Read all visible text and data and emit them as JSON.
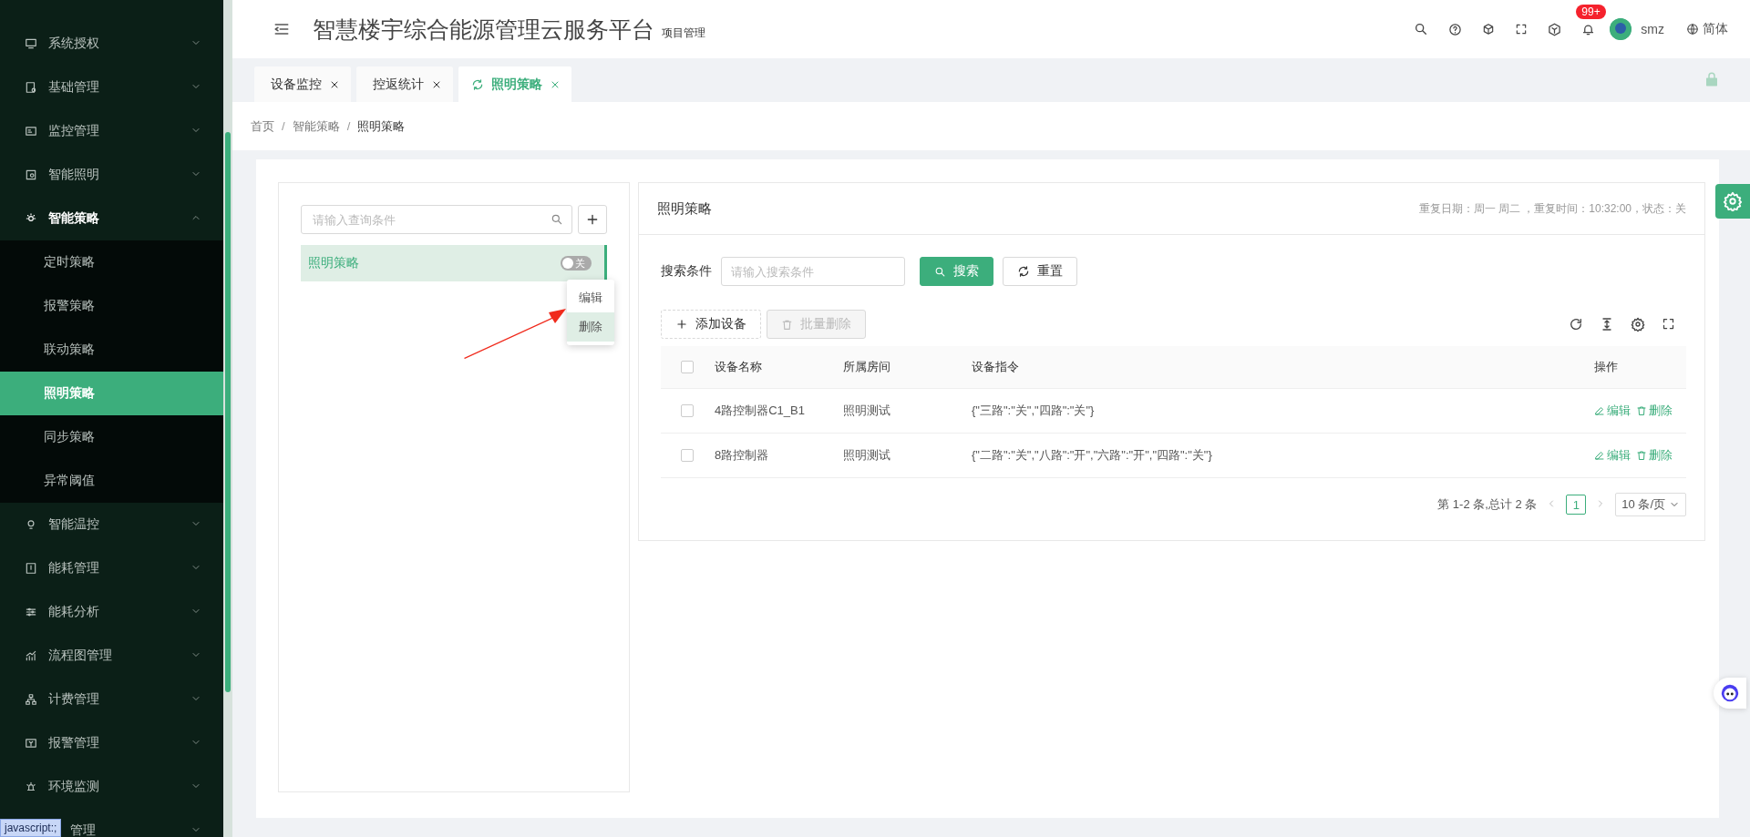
{
  "sidebar": {
    "items": [
      {
        "label": "系统授权",
        "expanded": false
      },
      {
        "label": "基础管理",
        "expanded": false
      },
      {
        "label": "监控管理",
        "expanded": false
      },
      {
        "label": "智能照明",
        "expanded": false
      },
      {
        "label": "智能策略",
        "expanded": true,
        "children": [
          {
            "label": "定时策略",
            "selected": false
          },
          {
            "label": "报警策略",
            "selected": false
          },
          {
            "label": "联动策略",
            "selected": false
          },
          {
            "label": "照明策略",
            "selected": true
          },
          {
            "label": "同步策略",
            "selected": false
          },
          {
            "label": "异常阈值",
            "selected": false
          }
        ]
      },
      {
        "label": "智能温控",
        "expanded": false
      },
      {
        "label": "能耗管理",
        "expanded": false
      },
      {
        "label": "能耗分析",
        "expanded": false
      },
      {
        "label": "流程图管理",
        "expanded": false
      },
      {
        "label": "计费管理",
        "expanded": false
      },
      {
        "label": "报警管理",
        "expanded": false
      },
      {
        "label": "环境监测",
        "expanded": false
      },
      {
        "label": "管理",
        "expanded": false
      }
    ]
  },
  "status_tooltip": "javascript:;",
  "header": {
    "title": "智慧楼宇综合能源管理云服务平台",
    "subtitle": "项目管理",
    "notification_badge": "99+",
    "user": "smz",
    "language": "简体"
  },
  "tabs": [
    {
      "label": "设备监控",
      "selected": false
    },
    {
      "label": "控返统计",
      "selected": false
    },
    {
      "label": "照明策略",
      "selected": true
    }
  ],
  "breadcrumb": [
    "首页",
    "智能策略",
    "照明策略"
  ],
  "breadcrumb_separator": "/",
  "strategy_list": {
    "search_placeholder": "请输入查询条件",
    "items": [
      {
        "label": "照明策略",
        "selected": true,
        "on": false,
        "switch_text": "关"
      }
    ],
    "context_menu": [
      {
        "label": "编辑",
        "selected": false
      },
      {
        "label": "删除",
        "selected": true
      }
    ]
  },
  "detail": {
    "title": "照明策略",
    "summary": "重复日期：周一 周二 ，重复时间：10:32:00，状态：关",
    "search_label": "搜索条件",
    "search_placeholder": "请输入搜索条件",
    "search_button": "搜索",
    "reset_button": "重置",
    "add_button": "添加设备",
    "batch_delete_button": "批量删除",
    "batch_delete_disabled": true,
    "table": {
      "select_all_checked": false,
      "columns": [
        "设备名称",
        "所属房间",
        "设备指令",
        "操作"
      ],
      "rows": [
        {
          "checked": false,
          "cells": [
            "4路控制器C1_B1",
            "照明测试",
            "{\"三路\":\"关\",\"四路\":\"关\"}"
          ],
          "actions": [
            "编辑",
            "删除"
          ]
        },
        {
          "checked": false,
          "cells": [
            "8路控制器",
            "照明测试",
            "{\"二路\":\"关\",\"八路\":\"开\",\"六路\":\"开\",\"四路\":\"关\"}"
          ],
          "actions": [
            "编辑",
            "删除"
          ]
        }
      ]
    },
    "pagination": {
      "summary": "第 1-2 条,总计 2 条",
      "pages": [
        {
          "label": "1",
          "selected": true
        }
      ],
      "page_size": "10 条/页"
    }
  }
}
